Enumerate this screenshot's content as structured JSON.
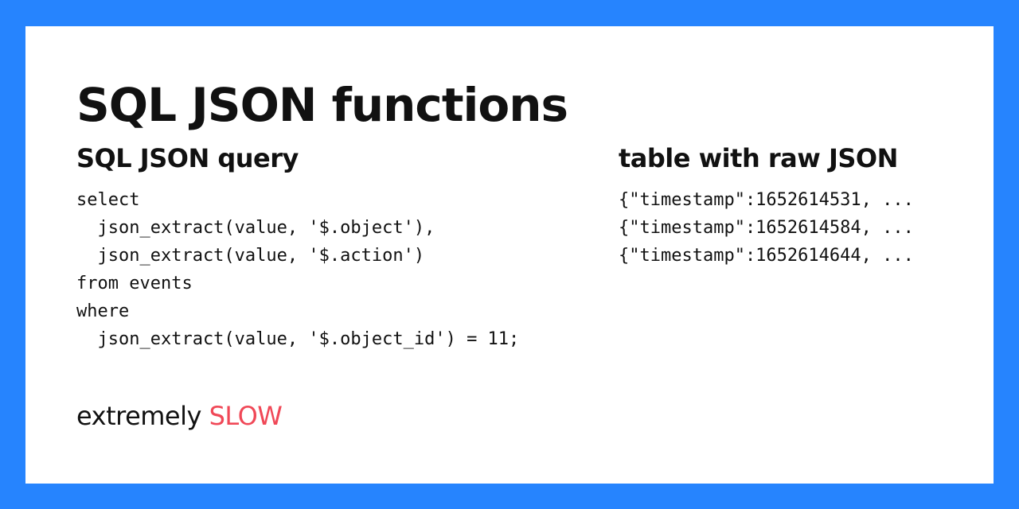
{
  "colors": {
    "frame_border": "#2684fe",
    "card_background": "#ffffff",
    "text": "#111111",
    "accent_slow": "#f04857"
  },
  "slide": {
    "title": "SQL JSON functions",
    "left_heading": "SQL JSON query",
    "right_heading": "table with raw JSON",
    "query_lines": [
      "select",
      "  json_extract(value, '$.object'),",
      "  json_extract(value, '$.action')",
      "from events",
      "where",
      "  json_extract(value, '$.object_id') = 11;"
    ],
    "json_rows": [
      "{\"timestamp\":1652614531, ...",
      "{\"timestamp\":1652614584, ...",
      "{\"timestamp\":1652614644, ..."
    ],
    "footer_prefix": "extremely",
    "footer_emphasis": "SLOW"
  }
}
